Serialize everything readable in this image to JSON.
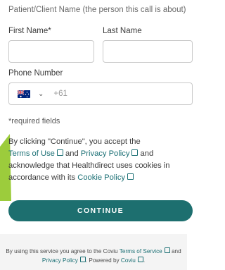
{
  "form": {
    "section_title": "Patient/Client Name (the person this call is about)",
    "first_name_label": "First Name*",
    "last_name_label": "Last Name",
    "first_name_value": "",
    "last_name_value": "",
    "phone_label": "Phone Number",
    "country_code": "+61",
    "required_note": "*required fields"
  },
  "consent": {
    "part1": "By clicking \"Continue\", you accept the",
    "terms": "Terms of Use",
    "and1": " and ",
    "privacy": "Privacy Policy",
    "part2": " and acknowledge that Healthdirect uses cookies in accordance with its ",
    "cookie": "Cookie Policy"
  },
  "button": {
    "continue_label": "CONTINUE"
  },
  "footer": {
    "prefix": "By using this service you agree to the Coviu ",
    "terms": "Terms of Service",
    "and": " and",
    "privacy": "Privacy Policy",
    "powered": ". Powered by ",
    "coviu": "Coviu",
    "end": "."
  },
  "colors": {
    "accent": "#1d6f6f",
    "highlight": "#9ccc3c"
  }
}
